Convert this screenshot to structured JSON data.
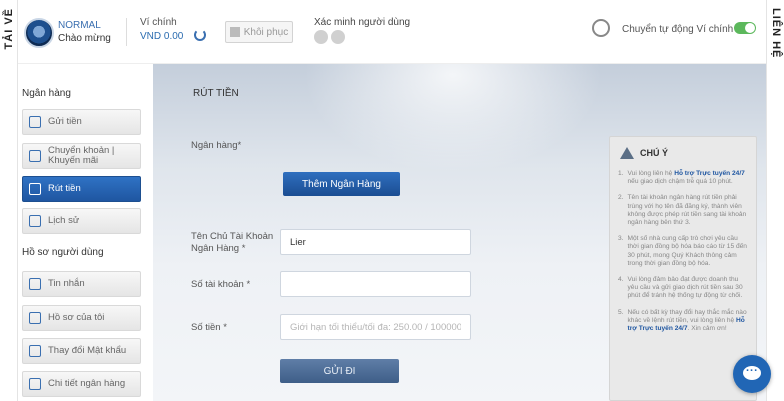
{
  "side_tabs": {
    "left": "TẢI VỀ",
    "right": "LIÊN HỆ"
  },
  "header": {
    "level": "NORMAL",
    "greeting": "Chào mừng",
    "wallet_label": "Ví chính",
    "wallet_amount": "VND 0.00",
    "restore_label": "Khôi phục",
    "verify_label": "Xác minh người dùng",
    "auto_transfer_label": "Chuyển tự động Ví chính",
    "auto_transfer_on": true
  },
  "sidebar": {
    "bank_section": "Ngân hàng",
    "bank_items": [
      {
        "label": "Gửi tiền",
        "icon": "deposit-icon",
        "active": false
      },
      {
        "label": "Chuyển khoản | Khuyến mãi",
        "icon": "transfer-promo-icon",
        "active": false
      },
      {
        "label": "Rút tiền",
        "icon": "withdraw-icon",
        "active": true
      },
      {
        "label": "Lịch sử",
        "icon": "history-icon",
        "active": false
      }
    ],
    "profile_section": "Hồ sơ người dùng",
    "profile_items": [
      {
        "label": "Tin nhắn",
        "icon": "mail-icon"
      },
      {
        "label": "Hồ sơ của tôi",
        "icon": "profile-icon"
      },
      {
        "label": "Thay đổi Mật khẩu",
        "icon": "key-icon"
      },
      {
        "label": "Chi tiết ngân hàng",
        "icon": "bank-icon"
      }
    ]
  },
  "main": {
    "title": "RÚT TIỀN",
    "bank_label": "Ngân hàng*",
    "add_bank_button": "Thêm Ngân Hàng",
    "account_name_label": "Tên Chủ Tài Khoản Ngân Hàng *",
    "account_name_value": "Lier",
    "account_number_label": "Số tài khoản *",
    "account_number_value": "",
    "amount_label": "Số tiền *",
    "amount_placeholder": "Giới hạn tối thiểu/tối đa: 250.00 / 100000.00",
    "submit_button": "GỬI ĐI"
  },
  "notes": {
    "title": "CHÚ Ý",
    "items": [
      {
        "num": "1.",
        "parts": [
          "Vui lòng liên hệ ",
          "Hỗ trợ Trực tuyến 24/7",
          " nếu giao dịch chậm trễ quá 10 phút."
        ]
      },
      {
        "num": "2.",
        "parts": [
          "Tên tài khoản ngân hàng rút tiền phải trùng với họ tên đã đăng ký, thành viên không được phép rút tiền sang tài khoản ngân hàng bên thứ 3.",
          "",
          ""
        ]
      },
      {
        "num": "3.",
        "parts": [
          "Một số nhà cung cấp trò chơi yêu cầu thời gian đồng bộ hóa báo cáo từ 15 đến 30 phút, mong Quý Khách thông cảm trong thời gian đồng bộ hóa.",
          "",
          ""
        ]
      },
      {
        "num": "4.",
        "parts": [
          "Vui lòng đảm bảo đạt được doanh thu yêu cầu và gửi giao dịch rút tiền sau 30 phút để tránh hệ thống tự động từ chối.",
          "",
          ""
        ]
      },
      {
        "num": "5.",
        "parts": [
          "Nếu có bất kỳ thay đổi hay thắc mắc nào khác về lệnh rút tiền, vui lòng liên hệ ",
          "Hỗ trợ Trực tuyến 24/7",
          ". Xin cảm ơn!"
        ]
      }
    ]
  }
}
